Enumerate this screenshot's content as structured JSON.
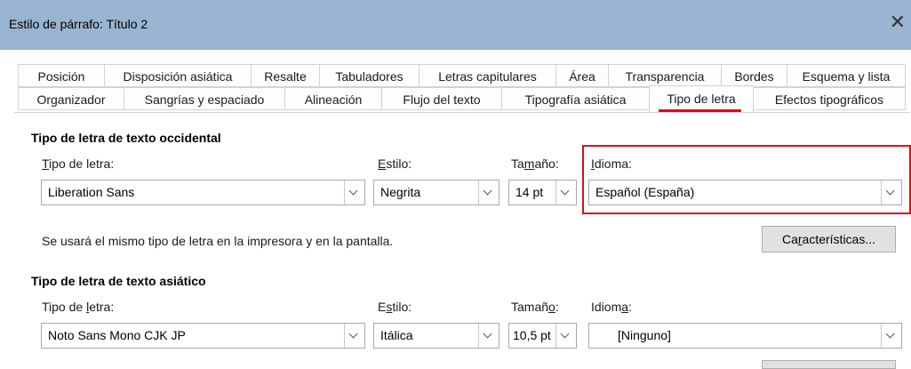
{
  "window": {
    "title": "Estilo de párrafo: Título 2",
    "close_icon": "close-icon"
  },
  "tabs_row1": [
    {
      "label": "Posición"
    },
    {
      "label": "Disposición asiática"
    },
    {
      "label": "Resalte"
    },
    {
      "label": "Tabuladores"
    },
    {
      "label": "Letras capitulares"
    },
    {
      "label": "Área"
    },
    {
      "label": "Transparencia"
    },
    {
      "label": "Bordes"
    },
    {
      "label": "Esquema y lista"
    }
  ],
  "tabs_row2": [
    {
      "label": "Organizador"
    },
    {
      "label": "Sangrías y espaciado"
    },
    {
      "label": "Alineación"
    },
    {
      "label": "Flujo del texto"
    },
    {
      "label": "Tipografía asiática"
    },
    {
      "label": "Tipo de letra"
    },
    {
      "label": "Efectos tipográficos"
    }
  ],
  "active_tab": "Tipo de letra",
  "accent_color": "#d4121c",
  "western": {
    "heading": "Tipo de letra de texto occidental",
    "font_label": {
      "mnemonic": "T",
      "rest": "ipo de letra:"
    },
    "style_label": {
      "mnemonic": "E",
      "rest": "stilo:"
    },
    "size_label": {
      "before": "Ta",
      "mnemonic": "m",
      "rest": "año:"
    },
    "lang_label": {
      "mnemonic": "I",
      "rest": "dioma:"
    },
    "font_value": "Liberation Sans",
    "style_value": "Negrita",
    "size_value": "14 pt",
    "lang_value": "Español (España)",
    "note": "Se usará el mismo tipo de letra en la impresora y en la pantalla.",
    "features_button": {
      "before": "Ca",
      "mnemonic": "r",
      "rest": "acterísticas..."
    }
  },
  "asian": {
    "heading": "Tipo de letra de texto asiático",
    "font_label": {
      "before": "Tipo de ",
      "mnemonic": "l",
      "rest": "etra:"
    },
    "style_label": {
      "before": "E",
      "mnemonic": "s",
      "rest": "tilo:"
    },
    "size_label": {
      "before": "Tamañ",
      "mnemonic": "o",
      "rest": ":"
    },
    "lang_label": {
      "before": "Idiom",
      "mnemonic": "a",
      "rest": ":"
    },
    "font_value": "Noto Sans Mono CJK JP",
    "style_value": "Itálica",
    "size_value": "10,5 pt",
    "lang_value": "[Ninguno]"
  }
}
